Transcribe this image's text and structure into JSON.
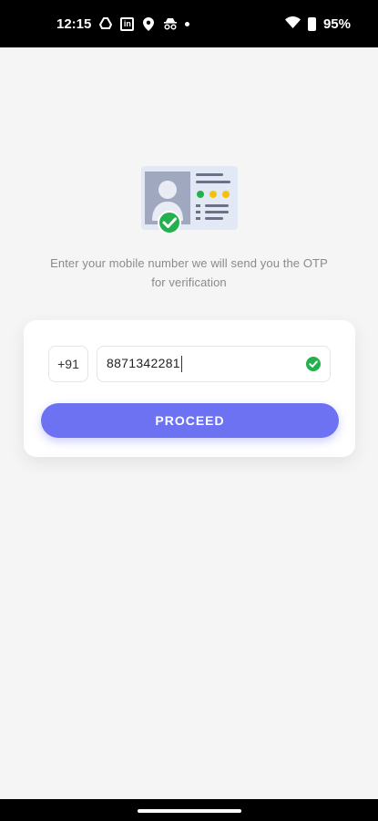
{
  "status_bar": {
    "time": "12:15",
    "battery_text": "95%",
    "icons": [
      "drive-icon",
      "linkedin-icon",
      "location-icon",
      "incognito-icon",
      "notification-dot",
      "wifi-icon",
      "battery-icon"
    ],
    "linkedin_glyph": "in"
  },
  "verification": {
    "instruction": "Enter your mobile number we will send you the OTP for verification",
    "illustration_icon": "id-card-verified-icon"
  },
  "form": {
    "country_code": "+91",
    "phone_number": "8871342281",
    "valid_icon": "check-circle-icon",
    "proceed_label": "PROCEED"
  },
  "colors": {
    "accent": "#6c72f2",
    "success": "#22b14c",
    "background": "#f5f5f5"
  }
}
